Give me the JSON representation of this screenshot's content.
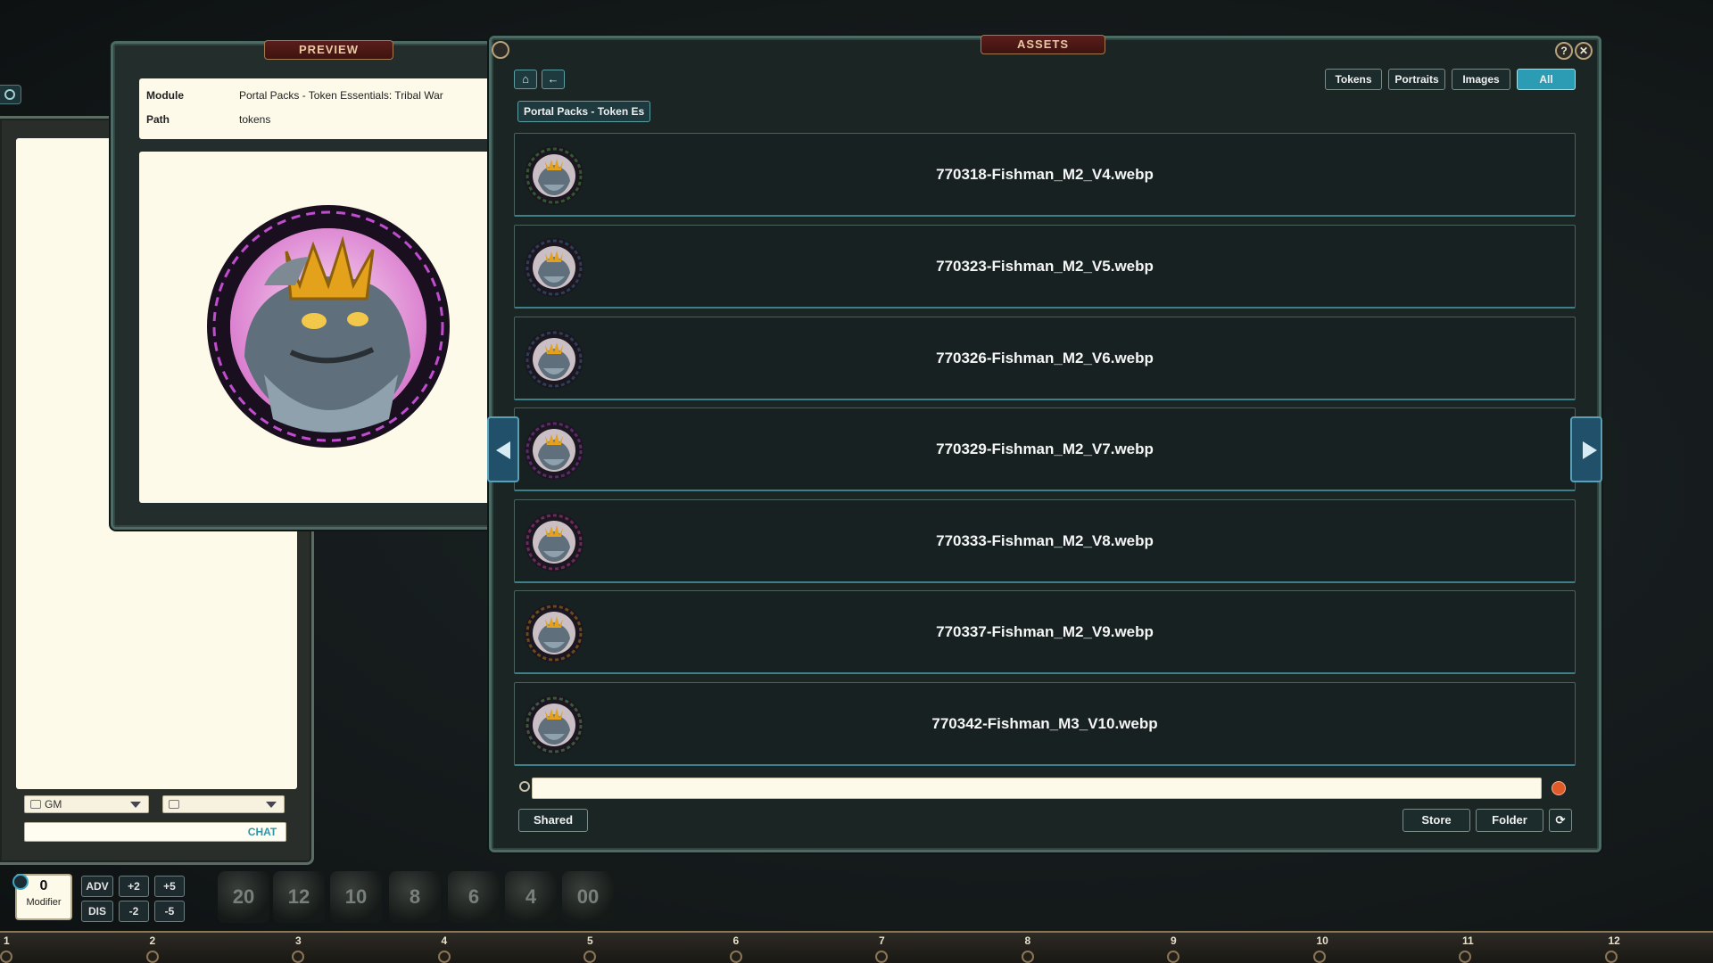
{
  "preview": {
    "title": "PREVIEW",
    "module_label": "Module",
    "module_value": "Portal Packs - Token Essentials: Tribal War",
    "path_label": "Path",
    "path_value": "tokens"
  },
  "assets": {
    "title": "ASSETS",
    "help": "?",
    "close": "✕",
    "home_icon": "⌂",
    "back_icon": "←",
    "filters": [
      {
        "label": "Tokens",
        "active": false
      },
      {
        "label": "Portraits",
        "active": false
      },
      {
        "label": "Images",
        "active": false
      },
      {
        "label": "All",
        "active": true
      }
    ],
    "breadcrumb": "Portal Packs - Token Es",
    "items": [
      {
        "name": "770318-Fishman_M2_V4.webp",
        "ring": "#2e5b2e"
      },
      {
        "name": "770323-Fishman_M2_V5.webp",
        "ring": "#2b3f55"
      },
      {
        "name": "770326-Fishman_M2_V6.webp",
        "ring": "#2b3f55"
      },
      {
        "name": "770329-Fishman_M2_V7.webp",
        "ring": "#5a2a6a"
      },
      {
        "name": "770333-Fishman_M2_V8.webp",
        "ring": "#6a2a5a"
      },
      {
        "name": "770337-Fishman_M2_V9.webp",
        "ring": "#6a4a1a"
      },
      {
        "name": "770342-Fishman_M3_V10.webp",
        "ring": "#3b5a3b"
      }
    ],
    "search_value": "",
    "shared": "Shared",
    "store": "Store",
    "folder": "Folder",
    "refresh_icon": "⟳"
  },
  "chat": {
    "identity": "GM",
    "mode": "",
    "send": "CHAT"
  },
  "modifier": {
    "value": "0",
    "label": "Modifier",
    "buttons": [
      "ADV",
      "+2",
      "+5",
      "DIS",
      "-2",
      "-5"
    ]
  },
  "dice": [
    "20",
    "12",
    "10",
    "8",
    "6",
    "4",
    "00"
  ],
  "ruler": [
    "1",
    "2",
    "3",
    "4",
    "5",
    "6",
    "7",
    "8",
    "9",
    "10",
    "11",
    "12"
  ]
}
